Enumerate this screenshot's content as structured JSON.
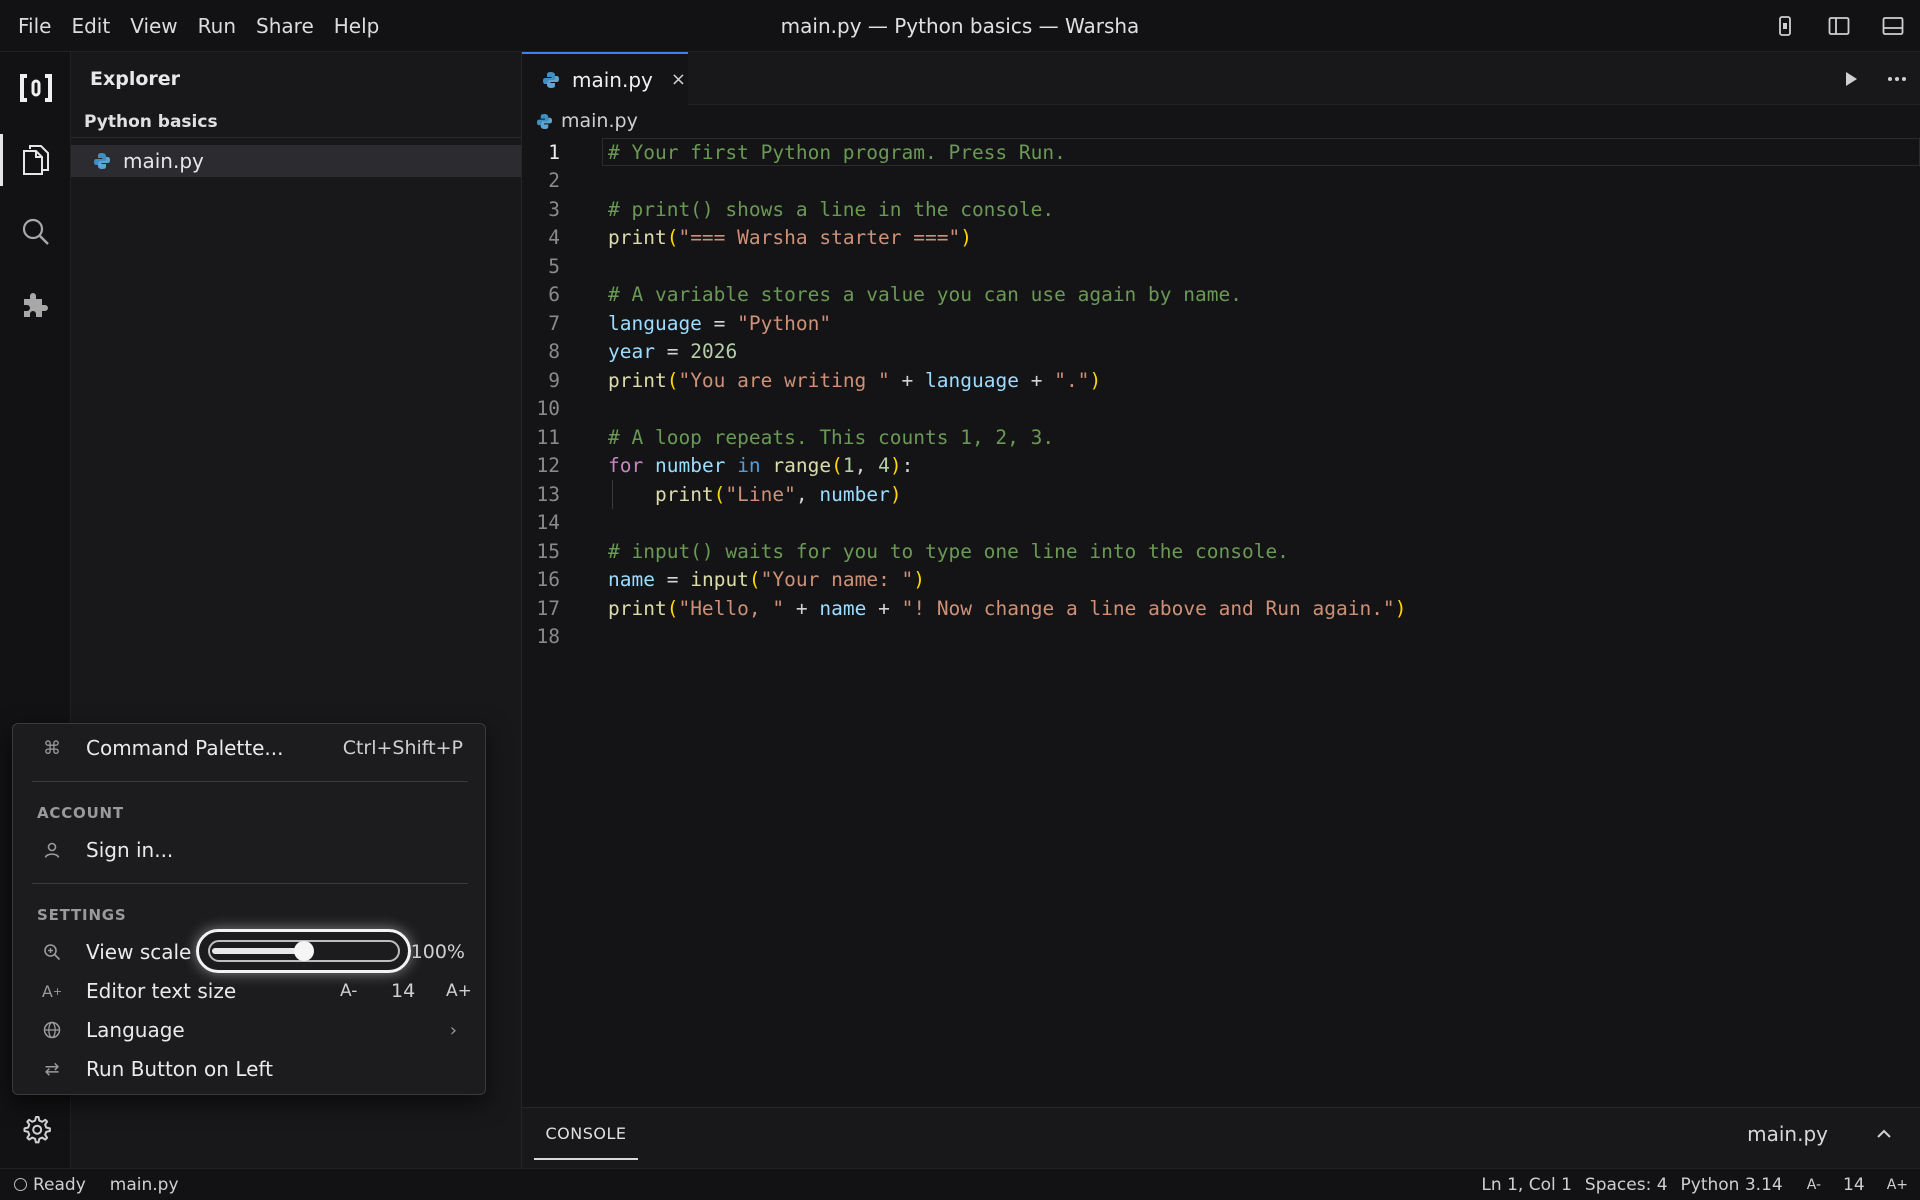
{
  "menubar": {
    "items": [
      "File",
      "Edit",
      "View",
      "Run",
      "Share",
      "Help"
    ]
  },
  "window": {
    "title": "main.py — Python basics — Warsha"
  },
  "activitybar": {
    "items": [
      "logo-icon",
      "files-icon",
      "search-icon",
      "extensions-icon"
    ],
    "active": "files-icon"
  },
  "sidebar": {
    "title": "Explorer",
    "folder": "Python basics",
    "files": [
      "main.py"
    ],
    "selected": "main.py"
  },
  "editor": {
    "tab": {
      "label": "main.py",
      "close": "×"
    },
    "breadcrumb": "main.py",
    "current_line": 1,
    "lines": [
      "# Your first Python program. Press Run.",
      "",
      "# print() shows a line in the console.",
      "print(\"=== Warsha starter ===\")",
      "",
      "# A variable stores a value you can use again by name.",
      "language = \"Python\"",
      "year = 2026",
      "print(\"You are writing \" + language + \".\")",
      "",
      "# A loop repeats. This counts 1, 2, 3.",
      "for number in range(1, 4):",
      "    print(\"Line\", number)",
      "",
      "# input() waits for you to type one line into the console.",
      "name = input(\"Your name: \")",
      "print(\"Hello, \" + name + \"! Now change a line above and Run again.\")",
      ""
    ]
  },
  "console": {
    "tab": "CONSOLE",
    "file": "main.py"
  },
  "statusbar": {
    "state": "Ready",
    "file": "main.py",
    "position": "Ln 1, Col 1",
    "spaces": "Spaces: 4",
    "language": "Python 3.14",
    "font_minus": "A-",
    "font_size": "14",
    "font_plus": "A+"
  },
  "popup": {
    "command_palette": {
      "label": "Command Palette...",
      "shortcut": "Ctrl+Shift+P",
      "icon": "command-icon"
    },
    "account_header": "ACCOUNT",
    "sign_in": {
      "label": "Sign in...",
      "icon": "user-icon"
    },
    "settings_header": "SETTINGS",
    "view_scale": {
      "label": "View scale",
      "value": "100%",
      "slider_fraction": 0.5,
      "icon": "zoom-icon"
    },
    "editor_text_size": {
      "label": "Editor text size",
      "minus": "A-",
      "value": "14",
      "plus": "A+",
      "icon": "text-size-icon"
    },
    "language": {
      "label": "Language",
      "chevron": "›",
      "icon": "globe-icon"
    },
    "run_button": {
      "label": "Run Button on Left",
      "icon": "swap-icon"
    }
  },
  "colors": {
    "comment": "#6a9955",
    "string": "#ce9178",
    "function": "#dcdcaa",
    "variable": "#9cdcfe",
    "keyword": "#c586c0",
    "accent": "#3b82f6"
  }
}
